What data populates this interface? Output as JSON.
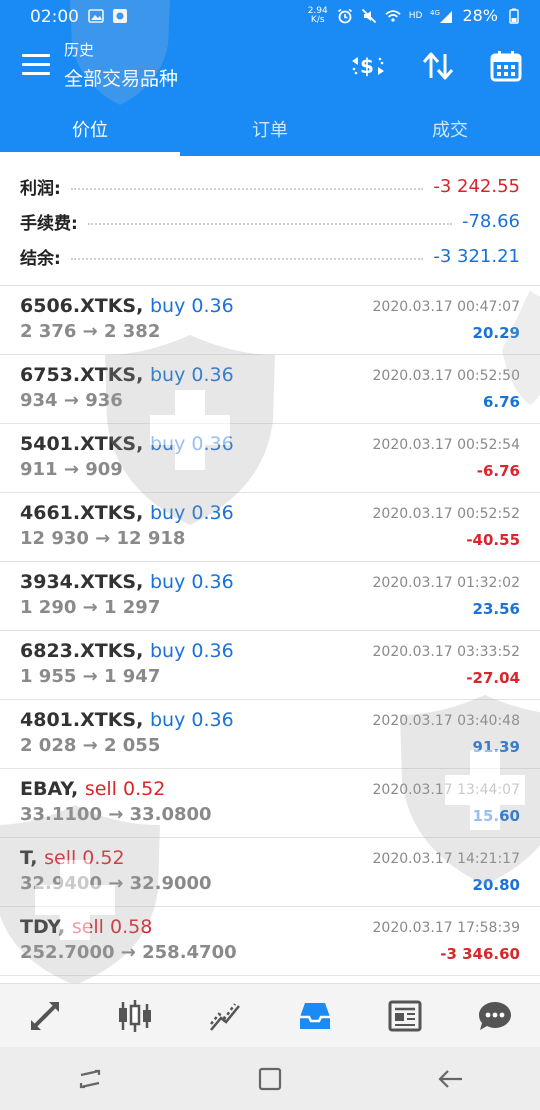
{
  "status_bar": {
    "time": "02:00",
    "net_speed_top": "2.94",
    "net_speed_unit": "K/s",
    "network": "HD",
    "signal": "4G",
    "battery": "28%"
  },
  "app_bar": {
    "title_small": "历史",
    "title_big": "全部交易品种"
  },
  "tabs": [
    {
      "label": "价位",
      "active": true
    },
    {
      "label": "订单",
      "active": false
    },
    {
      "label": "成交",
      "active": false
    }
  ],
  "summary": {
    "profit_label": "利润:",
    "profit_value": "-3 242.55",
    "commission_label": "手续费:",
    "commission_value": "-78.66",
    "balance_label": "结余:",
    "balance_value": "-3 321.21"
  },
  "deals": [
    {
      "symbol": "6506.XTKS,",
      "type": "buy 0.36",
      "side": "buy",
      "prices": "2 376 → 2 382",
      "time": "2020.03.17 00:47:07",
      "profit": "20.29",
      "sign": "pos"
    },
    {
      "symbol": "6753.XTKS,",
      "type": "buy 0.36",
      "side": "buy",
      "prices": "934 → 936",
      "time": "2020.03.17 00:52:50",
      "profit": "6.76",
      "sign": "pos"
    },
    {
      "symbol": "5401.XTKS,",
      "type": "buy 0.36",
      "side": "buy",
      "prices": "911 → 909",
      "time": "2020.03.17 00:52:54",
      "profit": "-6.76",
      "sign": "neg"
    },
    {
      "symbol": "4661.XTKS,",
      "type": "buy 0.36",
      "side": "buy",
      "prices": "12 930 → 12 918",
      "time": "2020.03.17 00:52:52",
      "profit": "-40.55",
      "sign": "neg"
    },
    {
      "symbol": "3934.XTKS,",
      "type": "buy 0.36",
      "side": "buy",
      "prices": "1 290 → 1 297",
      "time": "2020.03.17 01:32:02",
      "profit": "23.56",
      "sign": "pos"
    },
    {
      "symbol": "6823.XTKS,",
      "type": "buy 0.36",
      "side": "buy",
      "prices": "1 955 → 1 947",
      "time": "2020.03.17 03:33:52",
      "profit": "-27.04",
      "sign": "neg"
    },
    {
      "symbol": "4801.XTKS,",
      "type": "buy 0.36",
      "side": "buy",
      "prices": "2 028 → 2 055",
      "time": "2020.03.17 03:40:48",
      "profit": "91.39",
      "sign": "pos"
    },
    {
      "symbol": "EBAY,",
      "type": "sell 0.52",
      "side": "sell",
      "prices": "33.1100 → 33.0800",
      "time": "2020.03.17 13:44:07",
      "profit": "15.60",
      "sign": "pos"
    },
    {
      "symbol": "T,",
      "type": "sell 0.52",
      "side": "sell",
      "prices": "32.9400 → 32.9000",
      "time": "2020.03.17 14:21:17",
      "profit": "20.80",
      "sign": "pos"
    },
    {
      "symbol": "TDY,",
      "type": "sell 0.58",
      "side": "sell",
      "prices": "252.7000 → 258.4700",
      "time": "2020.03.17 17:58:39",
      "profit": "-3 346.60",
      "sign": "neg"
    }
  ],
  "bottom_nav": [
    {
      "icon": "quotes-arrows-icon",
      "active": false
    },
    {
      "icon": "candlestick-chart-icon",
      "active": false
    },
    {
      "icon": "trade-trend-icon",
      "active": false
    },
    {
      "icon": "history-inbox-icon",
      "active": true
    },
    {
      "icon": "news-icon",
      "active": false
    },
    {
      "icon": "chat-bubble-icon",
      "active": false
    }
  ],
  "colors": {
    "primary": "#1a8af5",
    "positive": "#1a72d9",
    "negative": "#d9262c",
    "muted": "#8a8a8a"
  }
}
